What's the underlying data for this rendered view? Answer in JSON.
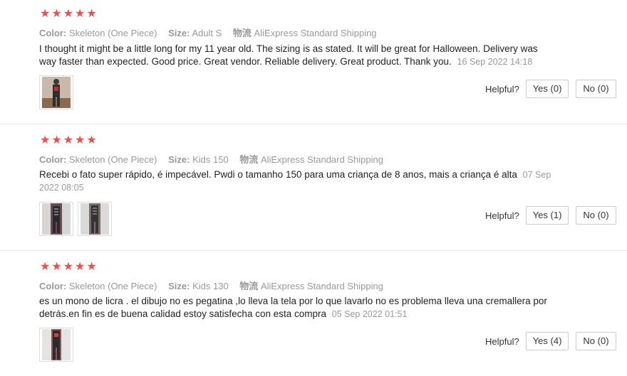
{
  "helpful_label": "Helpful?",
  "attr_labels": {
    "color": "Color:",
    "size": "Size:",
    "shipping": "物流"
  },
  "accent_color": "#f04d4d",
  "reviews": [
    {
      "rating": 5,
      "color": "Skeleton (One Piece)",
      "size": "Adult S",
      "shipping": "AliExpress Standard Shipping",
      "text": "I thought it might be a little long for my 11 year old. The sizing is as stated. It will be great for Halloween. Delivery was way faster than expected. Good price. Great vendor. Reliable delivery. Great product. Thank you.",
      "date": "16 Sep 2022 14:18",
      "yes_label": "Yes (0)",
      "no_label": "No (0)"
    },
    {
      "rating": 5,
      "color": "Skeleton (One Piece)",
      "size": "Kids 150",
      "shipping": "AliExpress Standard Shipping",
      "text": "Recebi o fato super rápido, é impecável. Pwdi o tamanho 150 para uma criança de 8 anos, mais a criança é alta",
      "date": "07 Sep 2022 08:05",
      "yes_label": "Yes (1)",
      "no_label": "No (0)"
    },
    {
      "rating": 5,
      "color": "Skeleton (One Piece)",
      "size": "Kids 130",
      "shipping": "AliExpress Standard Shipping",
      "text": "es un mono de licra . el dibujo no es pegatina ,lo lleva la tela por lo que lavarlo no es problema lleva una cremallera por detrás.en fin es de buena calidad estoy satisfecha con esta compra",
      "date": "05 Sep 2022 01:51",
      "yes_label": "Yes (4)",
      "no_label": "No (0)"
    }
  ]
}
